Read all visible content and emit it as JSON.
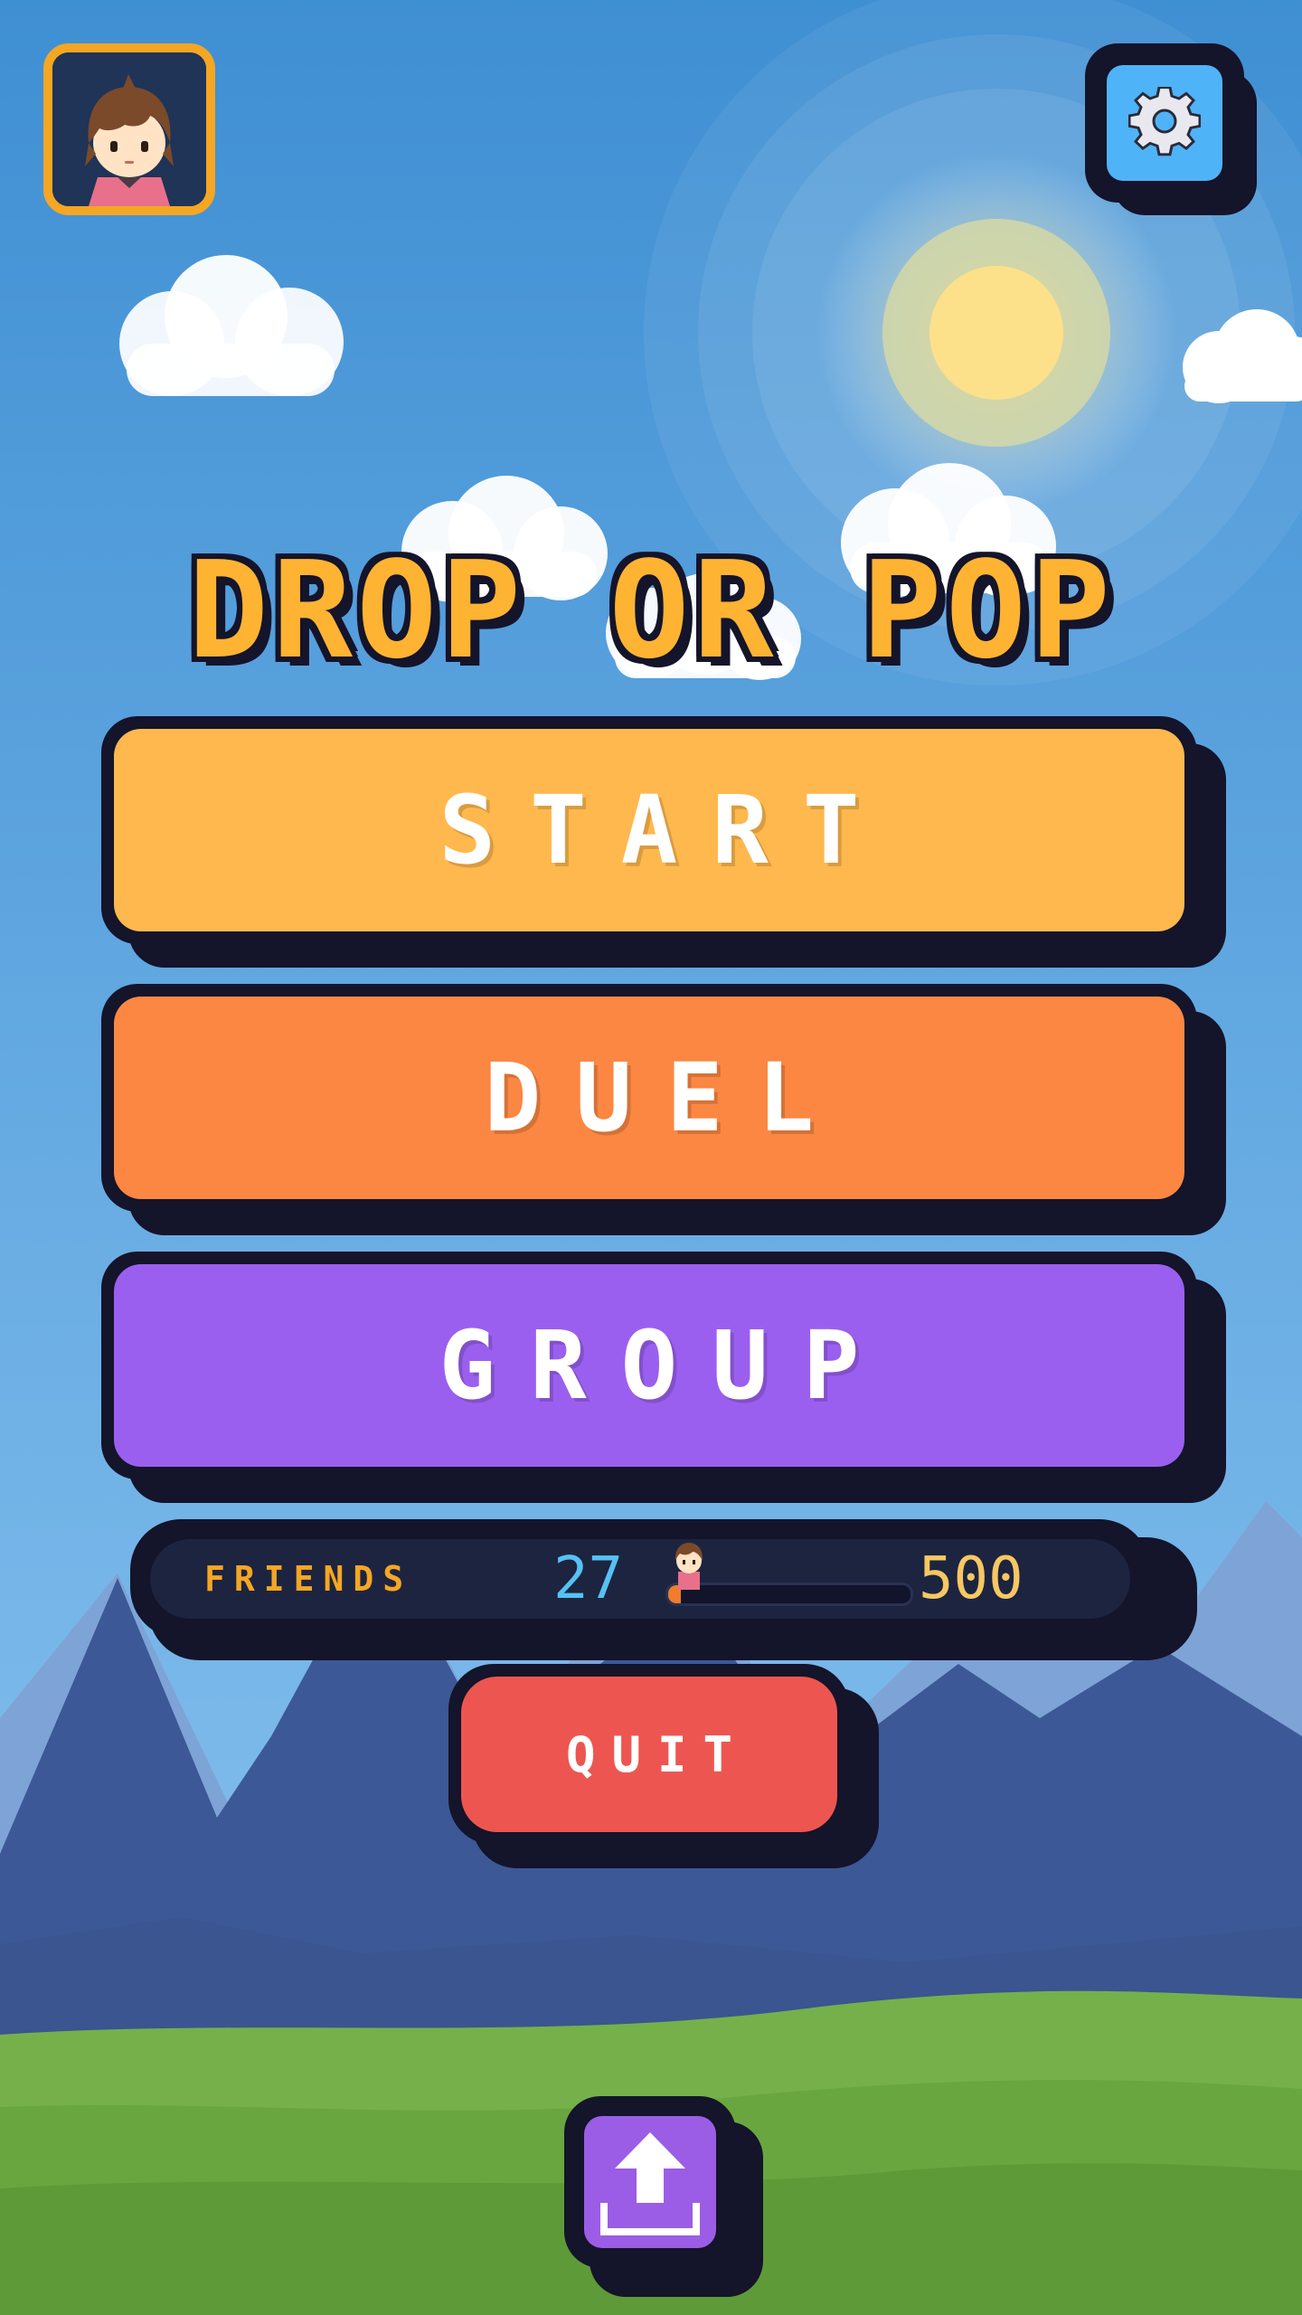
{
  "game": {
    "title": "DROP OR POP"
  },
  "menu": {
    "start_label": "START",
    "duel_label": "DUEL",
    "group_label": "GROUP",
    "quit_label": "QUIT"
  },
  "friends": {
    "label": "FRIENDS",
    "count": "27",
    "goal": "500",
    "progress_fraction": 0.054
  },
  "icons": {
    "settings": "gear-icon",
    "share": "upload-icon",
    "profile": "player-avatar"
  },
  "colors": {
    "start": "#ffb84d",
    "duel": "#fb8742",
    "group": "#9b5fef",
    "quit": "#ed5650",
    "settings": "#4fb3f7",
    "share": "#9b5de5",
    "title": "#ffb332"
  }
}
